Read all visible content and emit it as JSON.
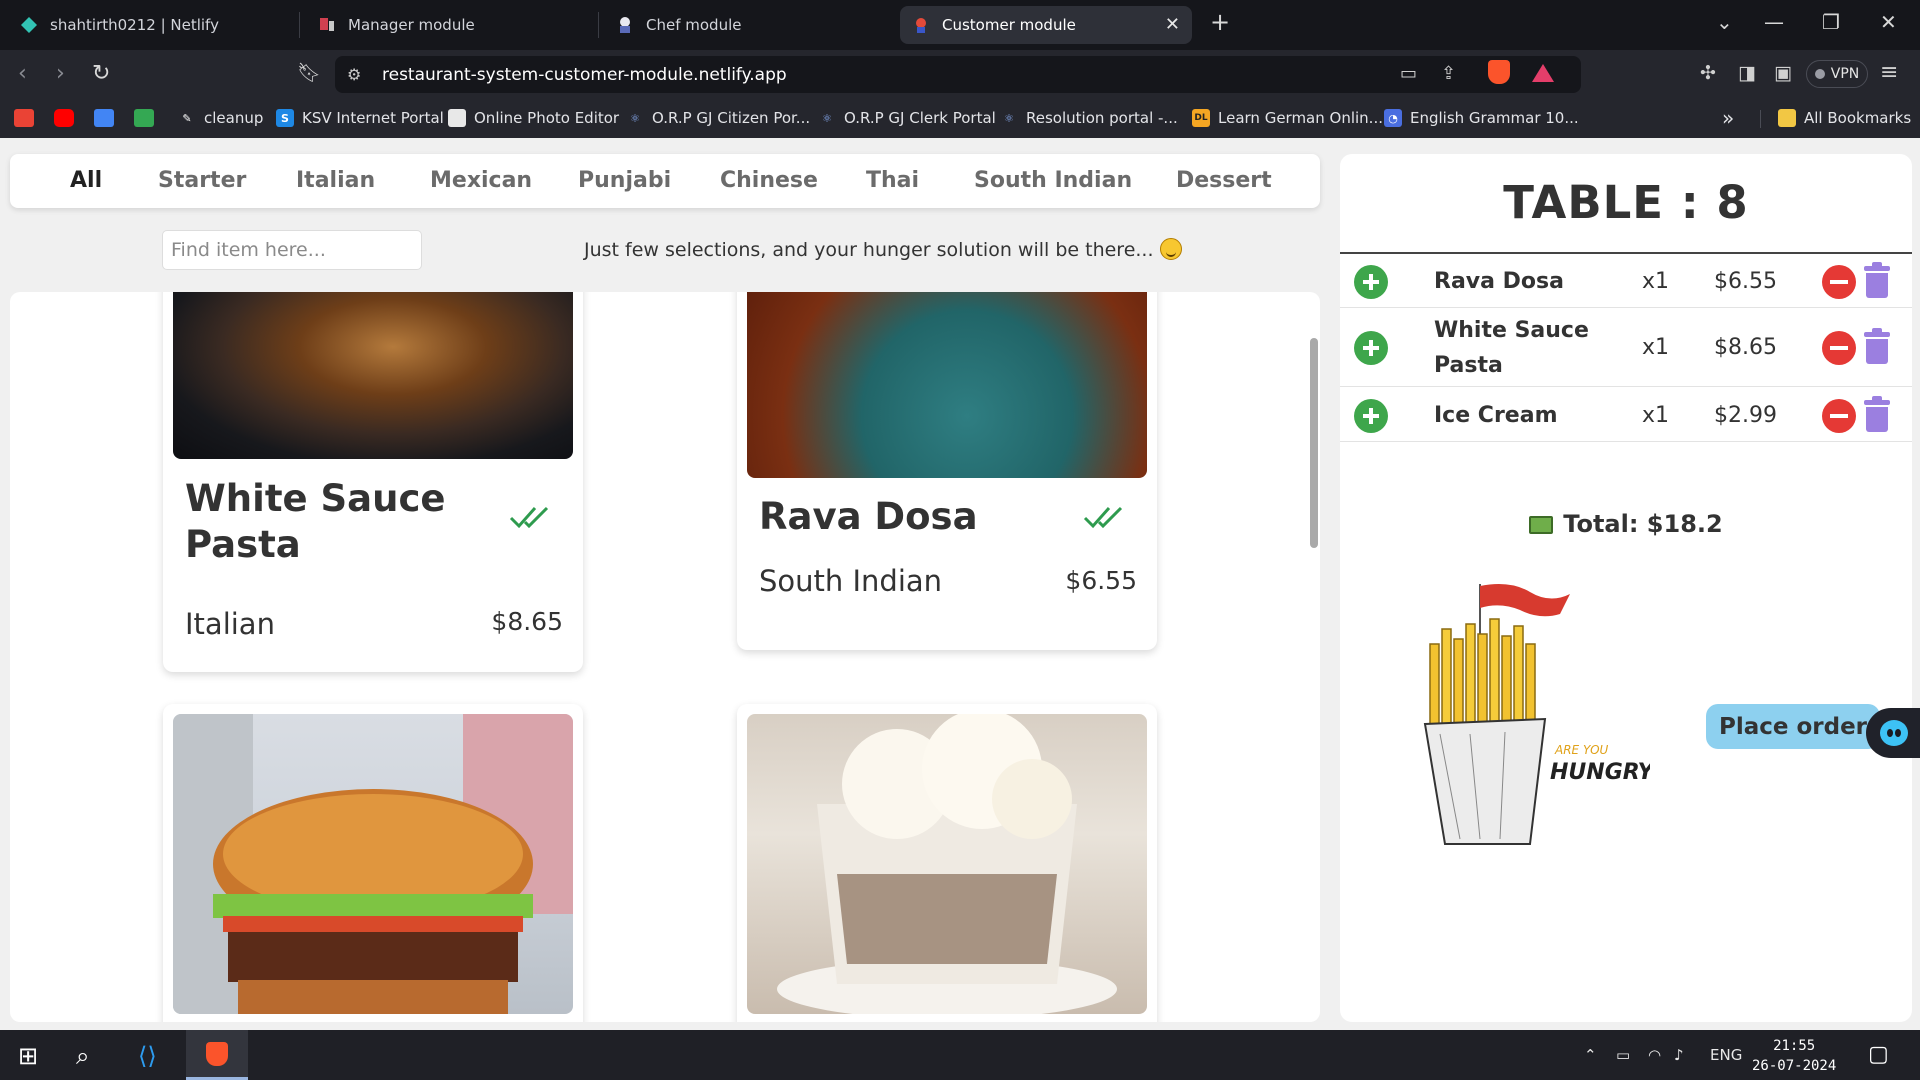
{
  "browser": {
    "tabs": [
      {
        "title": "shahtirth0212 | Netlify",
        "icon": "netlify-icon"
      },
      {
        "title": "Manager module",
        "icon": "manager-icon"
      },
      {
        "title": "Chef module",
        "icon": "chef-icon"
      },
      {
        "title": "Customer module",
        "icon": "customer-icon",
        "active": true
      }
    ],
    "url": "restaurant-system-customer-module.netlify.app",
    "vpn_label": "VPN",
    "bookmarks": [
      {
        "label": "cleanup"
      },
      {
        "label": "KSV Internet Portal"
      },
      {
        "label": "Online Photo Editor"
      },
      {
        "label": "O.R.P GJ Citizen Por..."
      },
      {
        "label": "O.R.P GJ Clerk Portal"
      },
      {
        "label": "Resolution portal -..."
      },
      {
        "label": "Learn German Onlin..."
      },
      {
        "label": "English Grammar 10..."
      }
    ],
    "all_bookmarks": "All Bookmarks"
  },
  "categories": [
    "All",
    "Starter",
    "Italian",
    "Mexican",
    "Punjabi",
    "Chinese",
    "Thai",
    "South Indian",
    "Dessert"
  ],
  "search": {
    "placeholder": "Find item here..."
  },
  "tagline": "Just few selections, and your hunger solution will be there...",
  "menu_items": [
    {
      "name": "White Sauce Pasta",
      "cuisine": "Italian",
      "price": "$8.65",
      "selected": true
    },
    {
      "name": "Rava Dosa",
      "cuisine": "South Indian",
      "price": "$6.55",
      "selected": true
    },
    {
      "name": "",
      "cuisine": "",
      "price": "",
      "image": "burger"
    },
    {
      "name": "",
      "cuisine": "",
      "price": "",
      "image": "ice-cream-sundae"
    }
  ],
  "order": {
    "table_title": "TABLE : 8",
    "items": [
      {
        "name": "Rava Dosa",
        "qty": "x1",
        "price": "$6.55"
      },
      {
        "name": "White Sauce Pasta",
        "qty": "x1",
        "price": "$8.65"
      },
      {
        "name": "Ice Cream",
        "qty": "x1",
        "price": "$2.99"
      }
    ],
    "total": "Total: $18.2",
    "place_order": "Place order",
    "illustration_text": [
      "ARE YOU",
      "HUNGRY"
    ]
  },
  "taskbar": {
    "lang": "ENG",
    "time": "21:55",
    "date": "26-07-2024"
  },
  "colors": {
    "accent_add": "#3ea64b",
    "accent_remove": "#e53935",
    "trash": "#9b7fe0",
    "place_order_bg": "#8dd0ef"
  }
}
